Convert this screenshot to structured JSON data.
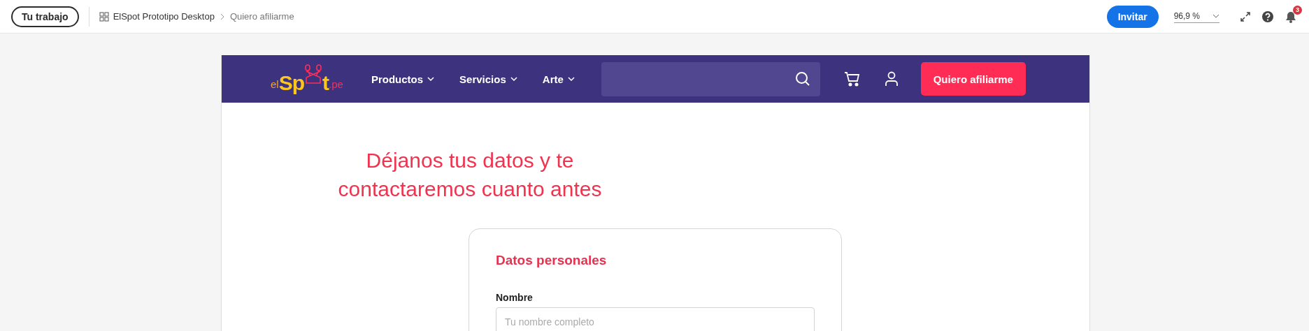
{
  "top_bar": {
    "home_button": "Tu trabajo",
    "breadcrumb": [
      {
        "label": "ElSpot Prototipo Desktop",
        "current": false
      },
      {
        "label": "Quiero afiliarme",
        "current": true
      }
    ],
    "invite_button": "Invitar",
    "zoom": "96,9 %",
    "notification_count": "3"
  },
  "site_header": {
    "logo": {
      "prefix": "el",
      "name_start": "Sp",
      "name_end": "t",
      "suffix": ".pe"
    },
    "nav": [
      {
        "label": "Productos",
        "has_menu": true
      },
      {
        "label": "Servicios",
        "has_menu": true
      },
      {
        "label": "Arte",
        "has_menu": true
      }
    ],
    "cta_button": "Quiero afiliarme"
  },
  "heading": "Déjanos tus datos y te contactaremos cuanto antes",
  "form": {
    "section_title": "Datos personales",
    "fields": [
      {
        "label": "Nombre",
        "placeholder": "Tu nombre completo"
      }
    ]
  }
}
